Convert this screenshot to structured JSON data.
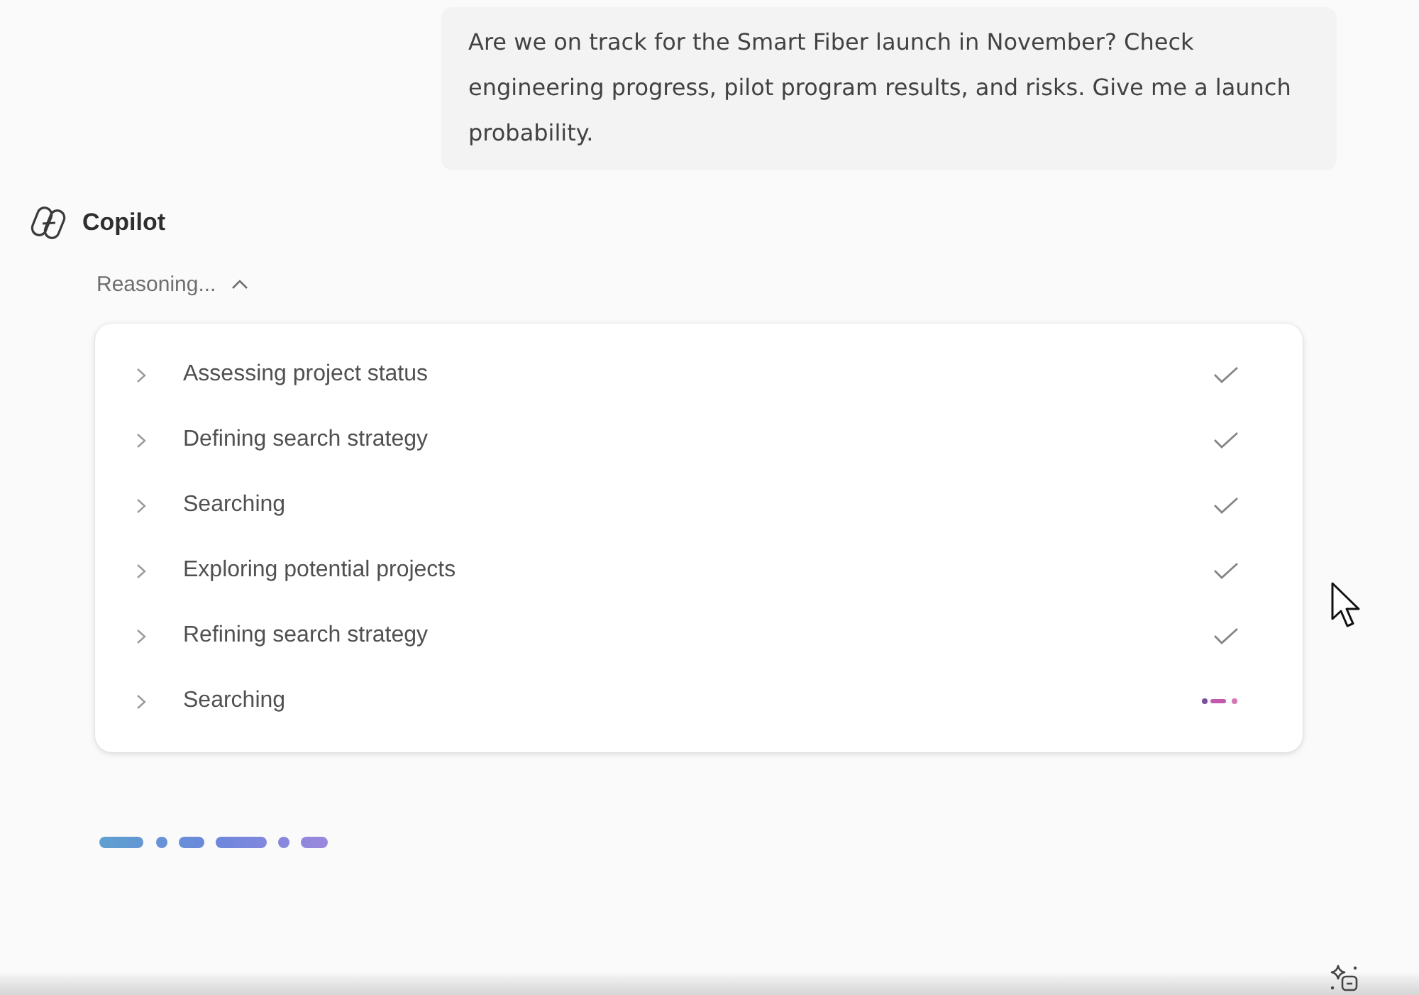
{
  "user_message": {
    "text": "Are we on track for the Smart Fiber launch in November? Check engineering progress, pilot program results, and risks. Give me a launch probability."
  },
  "assistant": {
    "name": "Copilot"
  },
  "reasoning": {
    "label": "Reasoning...",
    "expanded": true,
    "steps": [
      {
        "title": "Assessing project status",
        "expanded": false,
        "done": true
      },
      {
        "title": "Defining search strategy",
        "expanded": false,
        "done": true
      },
      {
        "title": "Searching",
        "expanded": false,
        "done": true
      },
      {
        "title": "Exploring potential projects",
        "expanded": false,
        "done": true
      },
      {
        "title": "Refining search strategy",
        "expanded": false,
        "done": true
      },
      {
        "title": "Searching",
        "expanded": false,
        "done": false
      }
    ]
  }
}
